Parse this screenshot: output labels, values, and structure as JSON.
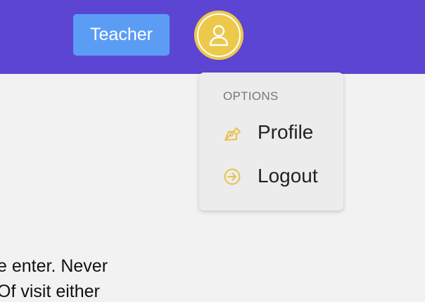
{
  "header": {
    "role_button_label": "Teacher",
    "avatar_icon": "user-icon"
  },
  "dropdown": {
    "header": "OPTIONS",
    "items": [
      {
        "label": "Profile",
        "icon": "pen-nib-icon"
      },
      {
        "label": "Logout",
        "icon": "sign-in-circle-icon"
      }
    ]
  },
  "content": {
    "lines": [
      "e enter. Never",
      "Of visit either"
    ]
  },
  "colors": {
    "topbar": "#5d45d3",
    "role_button": "#5b9df5",
    "avatar": "#ecc94b",
    "icon_accent": "#e7c14f"
  }
}
